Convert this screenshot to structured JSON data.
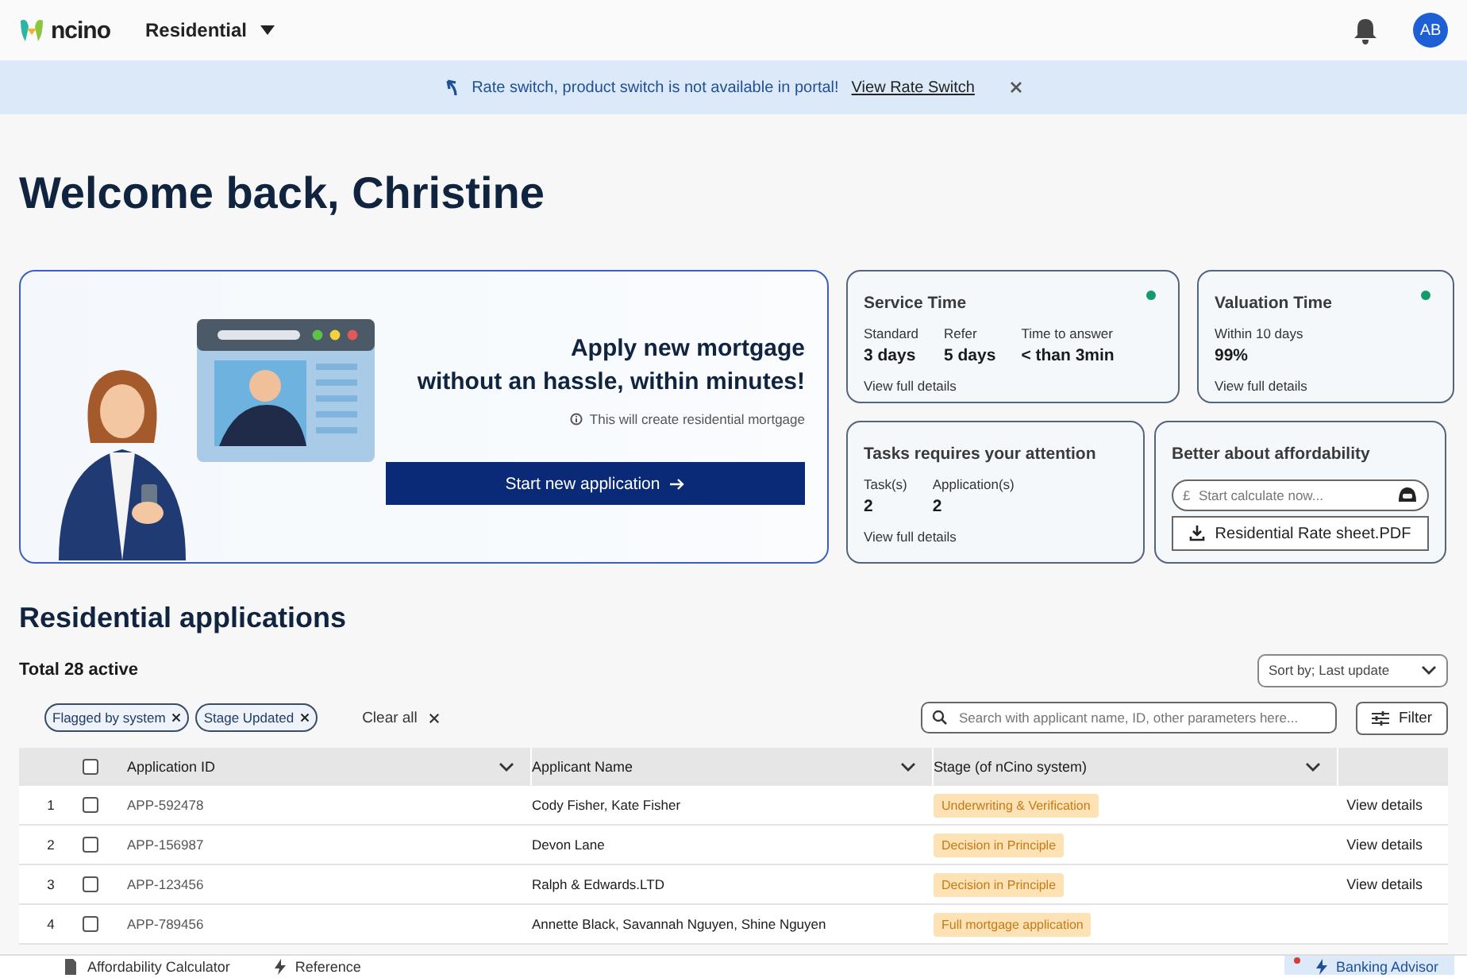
{
  "app_bar": {
    "logo": "ncino",
    "product_menu": "Residential",
    "avatar": "AB"
  },
  "banner": {
    "message": "Rate switch, product switch is not available in portal!",
    "link": "View Rate Switch"
  },
  "greeting": "Welcome back, Christine",
  "hero": {
    "title_lines": [
      "Apply new mortgage",
      "without an hassle, within minutes!"
    ],
    "note": "This will create residential mortgage",
    "button": "Start new application"
  },
  "stat_cards": [
    {
      "title": "Service Time",
      "stats": [
        {
          "label": "Standard",
          "value": "3 days"
        },
        {
          "label": "Refer",
          "value": "5 days"
        },
        {
          "label": "Time to answer",
          "value": "< than 3min"
        }
      ],
      "link": "View full details"
    },
    {
      "title": "Valuation Time",
      "stats": [
        {
          "label": "Within 10 days",
          "value": "99%"
        }
      ],
      "link": "View full details"
    },
    {
      "title": "Tasks requires your attention",
      "stats": [
        {
          "label": "Task(s)",
          "value": "2"
        },
        {
          "label": "Application(s)",
          "value": "2"
        }
      ],
      "link": "View full details"
    }
  ],
  "affordability": {
    "title": "Better about affordability",
    "currency": "£",
    "placeholder": "Start calculate now...",
    "button": "Residential Rate sheet.PDF"
  },
  "applications": {
    "title": "Residential applications",
    "total": "Total 28 active",
    "sort": "Sort by; Last update",
    "filters": [
      {
        "label": "Flagged by system"
      },
      {
        "label": "Stage Updated"
      }
    ],
    "clear": "Clear all",
    "search_placeholder": "Search with applicant name, ID, other parameters here...",
    "filter_button": "Filter",
    "select_all_checked": false,
    "columns": [
      "Application ID",
      "Applicant Name",
      "Stage (of nCino system)"
    ],
    "rows": [
      {
        "index": "1",
        "id": "APP-592478",
        "applicant": "Cody Fisher, Kate Fisher",
        "stage": "Underwriting & Verification",
        "action": "View details",
        "checked": false
      },
      {
        "index": "2",
        "id": "APP-156987",
        "applicant": "Devon Lane",
        "stage": "Decision in Principle",
        "action": "View details",
        "checked": false
      },
      {
        "index": "3",
        "id": "APP-123456",
        "applicant": "Ralph & Edwards.LTD",
        "stage": "Decision in Principle",
        "action": "View details",
        "checked": false
      },
      {
        "index": "4",
        "id": "APP-789456",
        "applicant": "Annette Black, Savannah Nguyen, Shine Nguyen",
        "stage": "Full mortgage application",
        "checked": false
      }
    ]
  },
  "bottom_bar": {
    "items": [
      "Affordability Calculator",
      "Reference"
    ],
    "advisor": "Banking Advisor"
  }
}
